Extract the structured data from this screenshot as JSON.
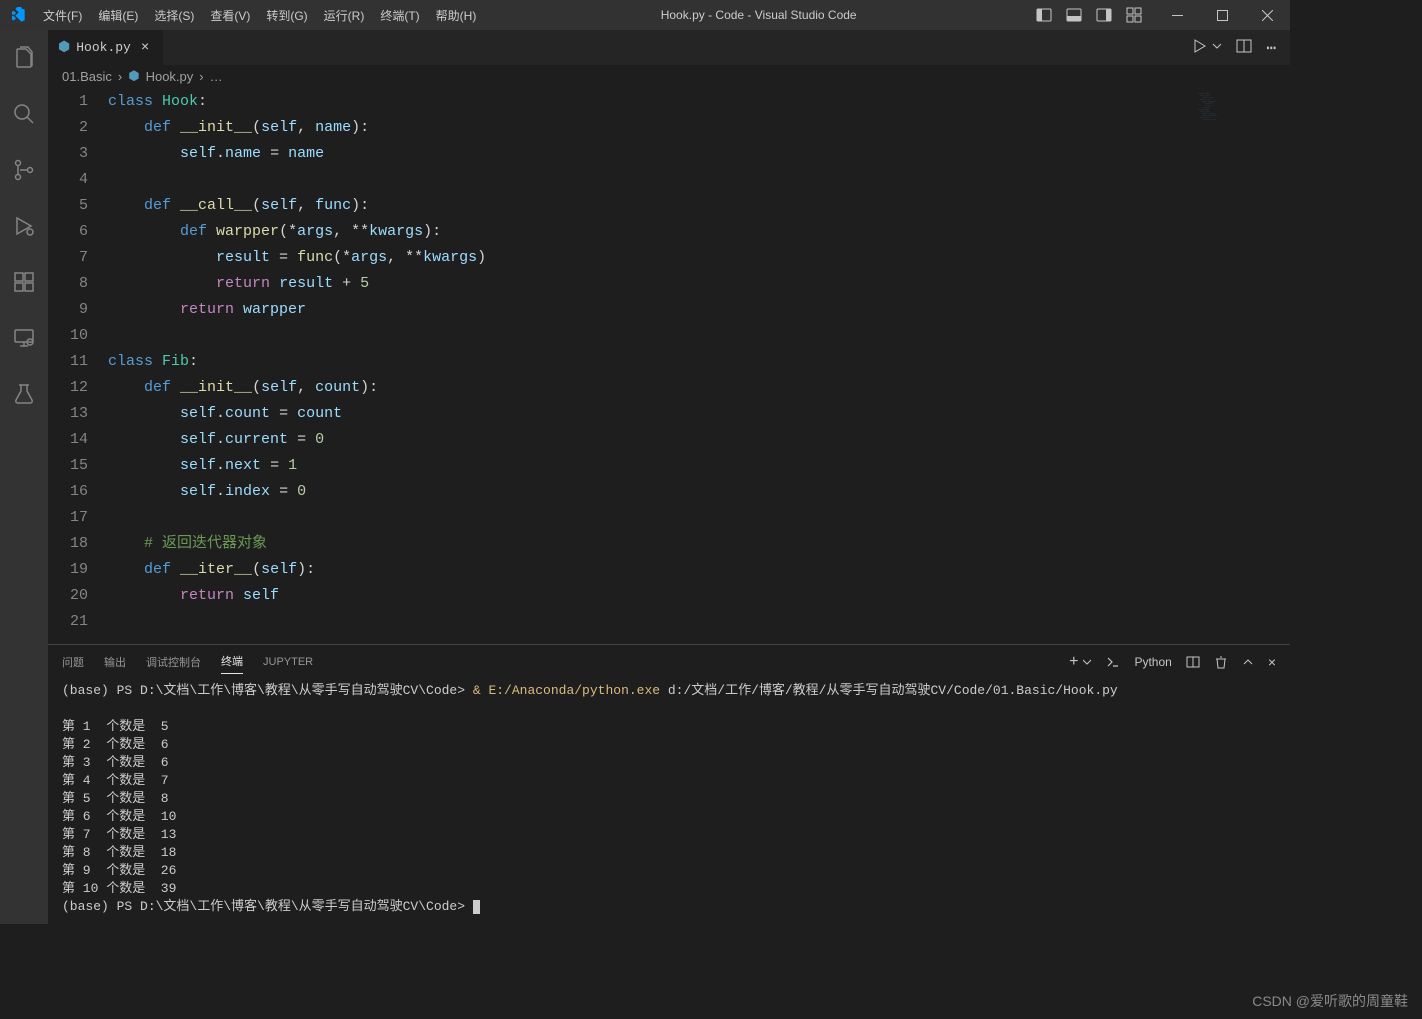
{
  "window": {
    "title": "Hook.py - Code - Visual Studio Code"
  },
  "menu": [
    "文件(F)",
    "编辑(E)",
    "选择(S)",
    "查看(V)",
    "转到(G)",
    "运行(R)",
    "终端(T)",
    "帮助(H)"
  ],
  "tab": {
    "icon": "py",
    "label": "Hook.py"
  },
  "breadcrumb": {
    "folder": "01.Basic",
    "file": "Hook.py",
    "more": "…"
  },
  "code": {
    "lines": [
      {
        "n": 1,
        "tokens": [
          [
            "kw-class",
            "class"
          ],
          [
            "op",
            " "
          ],
          [
            "cls-name",
            "Hook"
          ],
          [
            "punct",
            ":"
          ]
        ]
      },
      {
        "n": 2,
        "tokens": [
          [
            "op",
            "    "
          ],
          [
            "kw-def",
            "def"
          ],
          [
            "op",
            " "
          ],
          [
            "func-name",
            "__init__"
          ],
          [
            "punct",
            "("
          ],
          [
            "self",
            "self"
          ],
          [
            "punct",
            ", "
          ],
          [
            "param",
            "name"
          ],
          [
            "punct",
            "):"
          ]
        ]
      },
      {
        "n": 3,
        "tokens": [
          [
            "op",
            "        "
          ],
          [
            "self",
            "self"
          ],
          [
            "punct",
            "."
          ],
          [
            "attr",
            "name"
          ],
          [
            "op",
            " = "
          ],
          [
            "ident",
            "name"
          ]
        ]
      },
      {
        "n": 4,
        "tokens": []
      },
      {
        "n": 5,
        "tokens": [
          [
            "op",
            "    "
          ],
          [
            "kw-def",
            "def"
          ],
          [
            "op",
            " "
          ],
          [
            "func-name",
            "__call__"
          ],
          [
            "punct",
            "("
          ],
          [
            "self",
            "self"
          ],
          [
            "punct",
            ", "
          ],
          [
            "param",
            "func"
          ],
          [
            "punct",
            "):"
          ]
        ]
      },
      {
        "n": 6,
        "tokens": [
          [
            "op",
            "        "
          ],
          [
            "kw-def",
            "def"
          ],
          [
            "op",
            " "
          ],
          [
            "func-name",
            "warpper"
          ],
          [
            "punct",
            "(*"
          ],
          [
            "param",
            "args"
          ],
          [
            "punct",
            ", **"
          ],
          [
            "param",
            "kwargs"
          ],
          [
            "punct",
            "):"
          ]
        ]
      },
      {
        "n": 7,
        "tokens": [
          [
            "op",
            "            "
          ],
          [
            "ident",
            "result"
          ],
          [
            "op",
            " = "
          ],
          [
            "func-call",
            "func"
          ],
          [
            "punct",
            "(*"
          ],
          [
            "ident",
            "args"
          ],
          [
            "punct",
            ", **"
          ],
          [
            "ident",
            "kwargs"
          ],
          [
            "punct",
            ")"
          ]
        ]
      },
      {
        "n": 8,
        "tokens": [
          [
            "op",
            "            "
          ],
          [
            "kw-return",
            "return"
          ],
          [
            "op",
            " "
          ],
          [
            "ident",
            "result"
          ],
          [
            "op",
            " + "
          ],
          [
            "number",
            "5"
          ]
        ]
      },
      {
        "n": 9,
        "tokens": [
          [
            "op",
            "        "
          ],
          [
            "kw-return",
            "return"
          ],
          [
            "op",
            " "
          ],
          [
            "ident",
            "warpper"
          ]
        ]
      },
      {
        "n": 10,
        "tokens": []
      },
      {
        "n": 11,
        "tokens": [
          [
            "kw-class",
            "class"
          ],
          [
            "op",
            " "
          ],
          [
            "cls-name",
            "Fib"
          ],
          [
            "punct",
            ":"
          ]
        ]
      },
      {
        "n": 12,
        "tokens": [
          [
            "op",
            "    "
          ],
          [
            "kw-def",
            "def"
          ],
          [
            "op",
            " "
          ],
          [
            "func-name",
            "__init__"
          ],
          [
            "punct",
            "("
          ],
          [
            "self",
            "self"
          ],
          [
            "punct",
            ", "
          ],
          [
            "param",
            "count"
          ],
          [
            "punct",
            "):"
          ]
        ]
      },
      {
        "n": 13,
        "tokens": [
          [
            "op",
            "        "
          ],
          [
            "self",
            "self"
          ],
          [
            "punct",
            "."
          ],
          [
            "attr",
            "count"
          ],
          [
            "op",
            " = "
          ],
          [
            "ident",
            "count"
          ]
        ]
      },
      {
        "n": 14,
        "tokens": [
          [
            "op",
            "        "
          ],
          [
            "self",
            "self"
          ],
          [
            "punct",
            "."
          ],
          [
            "attr",
            "current"
          ],
          [
            "op",
            " = "
          ],
          [
            "number",
            "0"
          ]
        ]
      },
      {
        "n": 15,
        "tokens": [
          [
            "op",
            "        "
          ],
          [
            "self",
            "self"
          ],
          [
            "punct",
            "."
          ],
          [
            "attr",
            "next"
          ],
          [
            "op",
            " = "
          ],
          [
            "number",
            "1"
          ]
        ]
      },
      {
        "n": 16,
        "tokens": [
          [
            "op",
            "        "
          ],
          [
            "self",
            "self"
          ],
          [
            "punct",
            "."
          ],
          [
            "attr",
            "index"
          ],
          [
            "op",
            " = "
          ],
          [
            "number",
            "0"
          ]
        ]
      },
      {
        "n": 17,
        "tokens": []
      },
      {
        "n": 18,
        "tokens": [
          [
            "op",
            "    "
          ],
          [
            "comment",
            "# 返回迭代器对象"
          ]
        ]
      },
      {
        "n": 19,
        "tokens": [
          [
            "op",
            "    "
          ],
          [
            "kw-def",
            "def"
          ],
          [
            "op",
            " "
          ],
          [
            "func-name",
            "__iter__"
          ],
          [
            "punct",
            "("
          ],
          [
            "self",
            "self"
          ],
          [
            "punct",
            "):"
          ]
        ]
      },
      {
        "n": 20,
        "tokens": [
          [
            "op",
            "        "
          ],
          [
            "kw-return",
            "return"
          ],
          [
            "op",
            " "
          ],
          [
            "self",
            "self"
          ]
        ]
      },
      {
        "n": 21,
        "tokens": []
      }
    ]
  },
  "panel": {
    "tabs": [
      "问题",
      "输出",
      "调试控制台",
      "终端",
      "JUPYTER"
    ],
    "active_index": 3,
    "shell_label": "Python"
  },
  "terminal": {
    "prompt_prefix": "(base) PS D:\\文档\\工作\\博客\\教程\\从零手写自动驾驶CV\\Code>",
    "command": "& E:/Anaconda/python.exe d:/文档/工作/博客/教程/从零手写自动驾驶CV/Code/01.Basic/Hook.py",
    "output": [
      "第 1  个数是  5",
      "第 2  个数是  6",
      "第 3  个数是  6",
      "第 4  个数是  7",
      "第 5  个数是  8",
      "第 6  个数是  10",
      "第 7  个数是  13",
      "第 8  个数是  18",
      "第 9  个数是  26",
      "第 10 个数是  39"
    ]
  },
  "watermark": "CSDN @爱听歌的周童鞋"
}
